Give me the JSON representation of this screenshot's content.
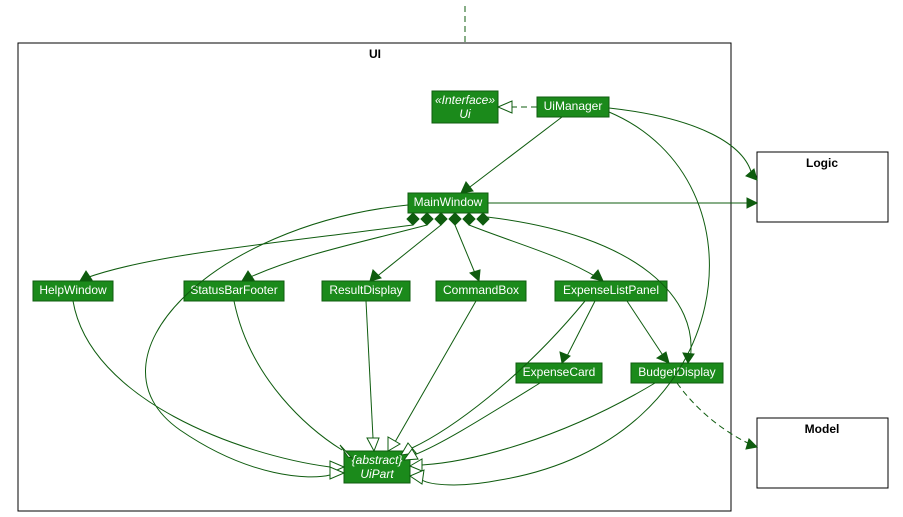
{
  "packages": {
    "ui": {
      "label": "UI"
    },
    "logic": {
      "label": "Logic"
    },
    "model": {
      "label": "Model"
    }
  },
  "nodes": {
    "uiInterface": {
      "stereo": "«Interface»",
      "name": "Ui"
    },
    "uiManager": {
      "name": "UiManager"
    },
    "mainWindow": {
      "name": "MainWindow"
    },
    "helpWindow": {
      "name": "HelpWindow"
    },
    "statusBarFooter": {
      "name": "StatusBarFooter"
    },
    "resultDisplay": {
      "name": "ResultDisplay"
    },
    "commandBox": {
      "name": "CommandBox"
    },
    "expenseListPanel": {
      "name": "ExpenseListPanel"
    },
    "expenseCard": {
      "name": "ExpenseCard"
    },
    "budgetDisplay": {
      "name": "BudgetDisplay"
    },
    "uiPart": {
      "stereo": "{abstract}",
      "name": "UiPart"
    }
  }
}
